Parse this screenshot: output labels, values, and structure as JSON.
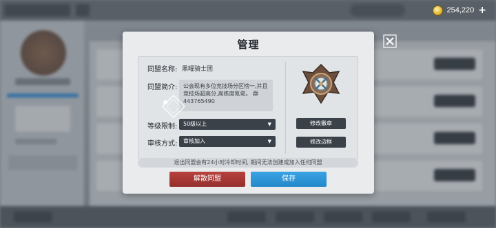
{
  "dialog": {
    "title": "管理",
    "close_icon": "close-x-icon"
  },
  "alliance": {
    "name_label": "同盟名称:",
    "name_value": "黑曜骑士团",
    "desc_label": "同盟简介:",
    "desc_value": "公会现有多位竞技场分区榜一,并且竞技场超高分,高练度氪佬。 群443765490",
    "level_label": "等级限制:",
    "level_value": "50级以上",
    "review_label": "审核方式:",
    "review_value": "审核加入"
  },
  "right_buttons": {
    "change_emblem": "修改徽章",
    "change_border": "修改边框"
  },
  "notice": "退出同盟会有24小时冷却时间, 期间无法创建或加入任何同盟",
  "actions": {
    "disband": "解散同盟",
    "save": "保存"
  },
  "currency": {
    "coin_value": "254,220",
    "plus": "+"
  },
  "colors": {
    "disband_red": "#a6373a",
    "save_blue": "#2f96d6",
    "dark_button": "#3a4149"
  }
}
